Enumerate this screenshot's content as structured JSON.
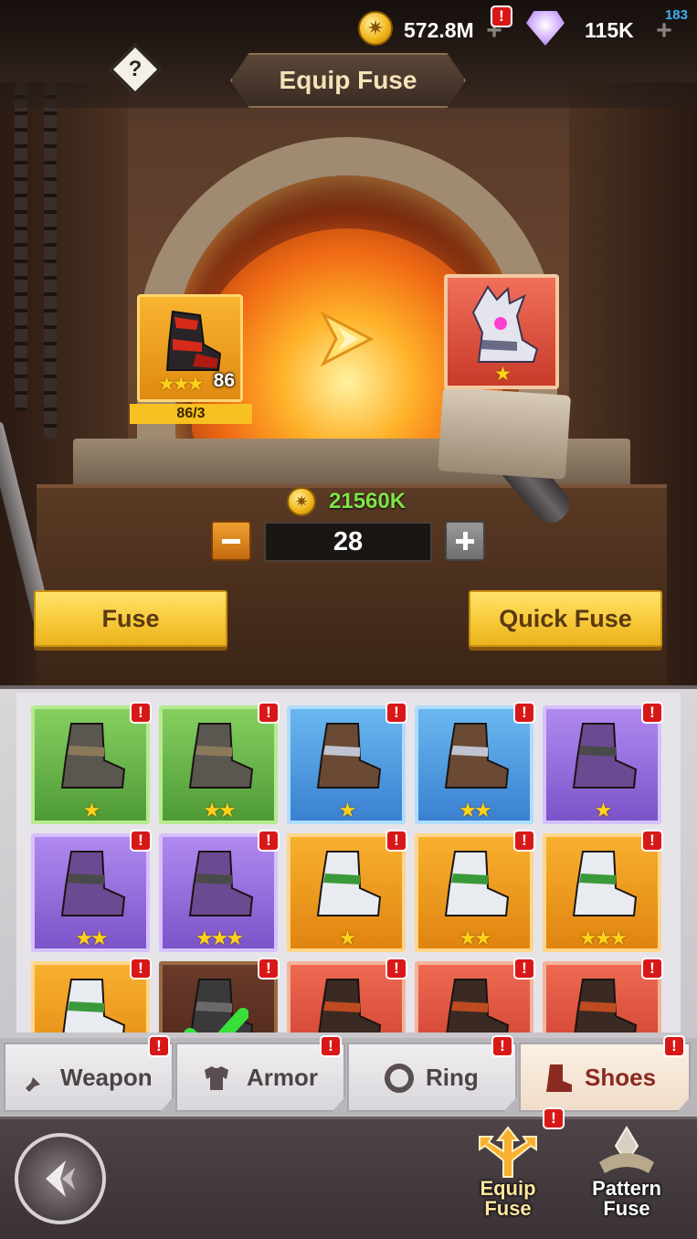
{
  "header": {
    "title": "Equip Fuse",
    "help_label": "?",
    "gold_amount": "572.8M",
    "gem_amount": "115K",
    "corner_counter": "183",
    "badge_mark": "!"
  },
  "fusion": {
    "source_level": "86",
    "source_stars": "★★★",
    "source_progress": "86/3",
    "source_progress_fraction": 1.0,
    "result_stars": "★",
    "cost": "21560K",
    "quantity": "28"
  },
  "buttons": {
    "fuse": "Fuse",
    "quick_fuse": "Quick Fuse"
  },
  "inventory": {
    "rows": [
      [
        {
          "rarity": "green",
          "stars": "★"
        },
        {
          "rarity": "green",
          "stars": "★★"
        },
        {
          "rarity": "blue",
          "stars": "★"
        },
        {
          "rarity": "blue",
          "stars": "★★"
        },
        {
          "rarity": "purple",
          "stars": "★"
        }
      ],
      [
        {
          "rarity": "purple",
          "stars": "★★"
        },
        {
          "rarity": "purple",
          "stars": "★★★"
        },
        {
          "rarity": "orange",
          "stars": "★"
        },
        {
          "rarity": "orange",
          "stars": "★★"
        },
        {
          "rarity": "orange",
          "stars": "★★★"
        }
      ],
      [
        {
          "rarity": "orange",
          "stars": ""
        },
        {
          "rarity": "dark",
          "stars": "",
          "selected": true
        },
        {
          "rarity": "red",
          "stars": ""
        },
        {
          "rarity": "red",
          "stars": ""
        },
        {
          "rarity": "red",
          "stars": ""
        }
      ]
    ]
  },
  "tabs": [
    {
      "label": "Weapon",
      "icon": "sword-icon"
    },
    {
      "label": "Armor",
      "icon": "armor-icon"
    },
    {
      "label": "Ring",
      "icon": "ring-icon"
    },
    {
      "label": "Shoes",
      "icon": "boot-icon",
      "active": true
    }
  ],
  "nav": {
    "equip_fuse": "Equip\nFuse",
    "equip_fuse_line1": "Equip",
    "equip_fuse_line2": "Fuse",
    "pattern_fuse_line1": "Pattern",
    "pattern_fuse_line2": "Fuse"
  },
  "colors": {
    "badge_red": "#d81818",
    "button_yellow": "#f6c634",
    "cost_green": "#7ee24a"
  }
}
